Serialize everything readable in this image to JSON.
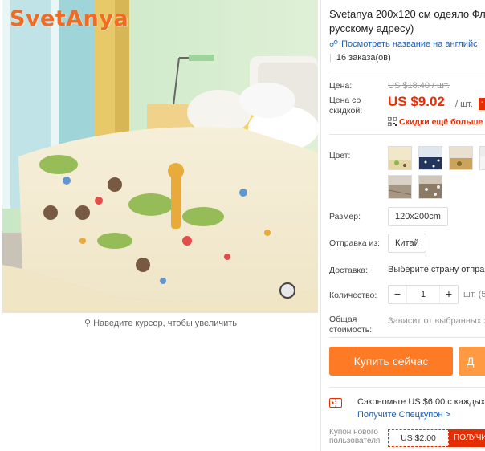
{
  "brand": {
    "logo_text": "SvetAnya",
    "color": "#f36b21"
  },
  "image": {
    "zoom_hint": "Наведите курсор, чтобы увеличить",
    "zoom_icon": "magnifier-icon"
  },
  "product": {
    "title_line1": "Svetanya 200x120 см одеяло Фла",
    "title_line2": "русскому адресу)",
    "translate_link": "Посмотреть название на английс",
    "orders": "16 заказа(ов)"
  },
  "pricing": {
    "price_label": "Цена:",
    "old_price": "US $18.40 / шт.",
    "discount_label_line1": "Цена со",
    "discount_label_line2": "скидкой:",
    "current_price": "US $9.02",
    "unit": "/ шт.",
    "badge": "-",
    "coupon_more": "Скидки ещё больше в"
  },
  "options": {
    "color_label": "Цвет:",
    "swatches": [
      "swatch-1",
      "swatch-2",
      "swatch-3",
      "swatch-4",
      "swatch-5"
    ],
    "size_label": "Размер:",
    "size_value": "120x200cm",
    "ship_from_label": "Отправка из:",
    "ship_from_value": "Китай",
    "delivery_label": "Доставка:",
    "delivery_value": "Выберите страну отправ",
    "qty_label": "Количество:",
    "qty_value": "1",
    "qty_minus": "−",
    "qty_plus": "+",
    "qty_unit": "шт. (5",
    "total_label_line1": "Общая",
    "total_label_line2": "стоимость:",
    "total_value": "Зависит от выбранных х"
  },
  "actions": {
    "buy_now": "Купить сейчас",
    "add_to_cart": "Д"
  },
  "promo": {
    "save_text": "Сэкономьте US $6.00 с каждых US",
    "special_coupon_link": "Получите Спецкупон >",
    "new_user_line1": "Купон нового",
    "new_user_line2": "пользователя",
    "coupon_value": "US $2.00",
    "get_coupon": "ПОЛУЧИ"
  },
  "colors": {
    "accent_red": "#e62e04",
    "buy_orange": "#ff7a24",
    "cart_orange": "#ff9a42",
    "link_blue": "#1a5fb4"
  }
}
